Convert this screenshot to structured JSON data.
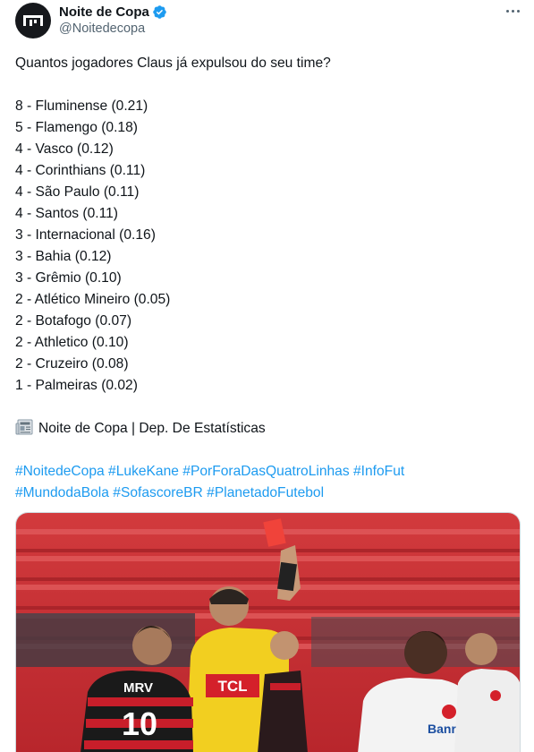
{
  "author": {
    "display_name": "Noite de Copa",
    "handle": "@Noitedecopa",
    "avatar_icon": "noite-de-copa-logo-icon",
    "verified_icon": "verified-badge-icon",
    "more_icon": "more-options-icon"
  },
  "tweet": {
    "question": "Quantos jogadores Claus já expulsou do seu time?",
    "rows": [
      "8 - Fluminense (0.21)",
      "5 - Flamengo (0.18)",
      "4 - Vasco (0.12)",
      "4 - Corinthians (0.11)",
      "4 - São Paulo (0.11)",
      "4 - Santos (0.11)",
      "3 - Internacional (0.16)",
      "3 - Bahia (0.12)",
      "3 - Grêmio (0.10)",
      "2 - Atlético Mineiro (0.05)",
      "2 - Botafogo (0.07)",
      "2 - Athletico (0.10)",
      "2 - Cruzeiro (0.08)",
      "1 - Palmeiras (0.02)"
    ],
    "signature": "Noite de Copa | Dep. De Estatísticas",
    "signature_icon": "newspaper-icon",
    "hashtags_line1": [
      "#NoitedeCopa",
      "#LukeKane",
      "#PorForaDasQuatroLinhas",
      "#InfoFut"
    ],
    "hashtags_line2": [
      "#MundodaBola",
      "#SofascoreBR",
      "#PlanetadoFutebol"
    ]
  },
  "media": {
    "description_icon": "red-card-photo",
    "jersey_number": "10",
    "jersey_sponsor": "MRV",
    "referee_sponsor": "TCL",
    "opponent_sponsor": "Banrisul"
  },
  "colors": {
    "link": "#1d9bf0",
    "text": "#0f1419",
    "secondary": "#536471",
    "verified": "#1d9bf0"
  }
}
